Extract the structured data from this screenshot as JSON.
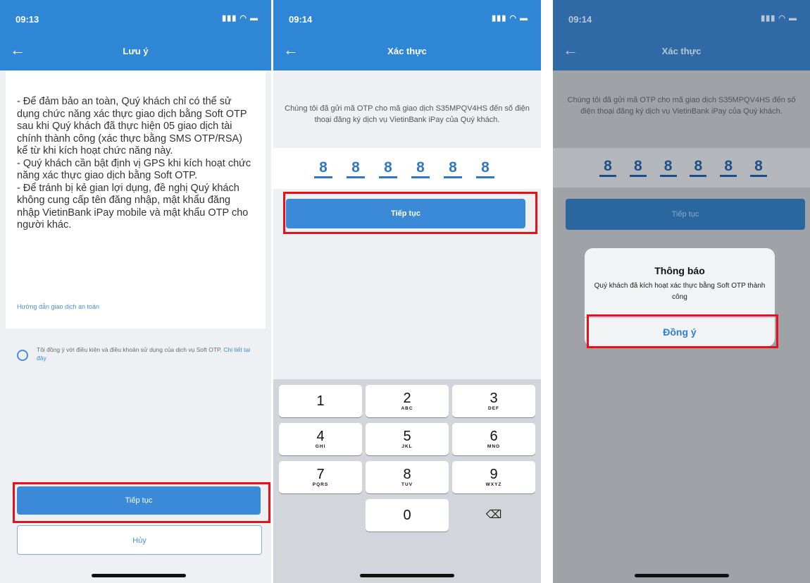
{
  "screen1": {
    "time": "09:13",
    "status_icons": "▮▮▮ ◠ ▬",
    "back_icon": "←",
    "title": "Lưu ý",
    "notice": [
      "- Để đảm bảo an toàn, Quý khách chỉ có thể sử dụng chức năng xác thực giao dịch bằng Soft OTP sau khi Quý khách đã thực hiện 05 giao dịch tài chính thành công  (xác thực bằng SMS OTP/RSA) kể từ khi kích hoạt chức năng này.",
      "- Quý khách cần bật định vị GPS khi kích hoạt chức năng xác thực giao dịch bằng Soft OTP.",
      "- Để tránh bị kẻ gian lợi dụng, đề nghị Quý khách không cung cấp tên đăng nhập, mật khẩu đăng nhập VietinBank iPay mobile và mật khẩu OTP cho người khác."
    ],
    "safe_link": "Hướng dẫn giao dịch an toàn",
    "agree_text": "Tôi đồng ý với điều kiện và điều khoản sử dụng của dịch vụ Soft OTP.",
    "agree_detail": "Chi tiết tại đây",
    "continue_label": "Tiếp tục",
    "cancel_label": "Hủy"
  },
  "screen2": {
    "time": "09:14",
    "status_icons": "▮▮▮ ◠ ▬",
    "back_icon": "←",
    "title": "Xác thực",
    "otp_message": "Chúng tôi đã gửi mã OTP cho mã giao dịch S35MPQV4HS đến số điện thoại đăng ký dịch vụ VietinBank iPay của Quý khách.",
    "otp_digits": [
      "8",
      "8",
      "8",
      "8",
      "8",
      "8"
    ],
    "continue_label": "Tiếp tục",
    "keys": [
      {
        "num": "1",
        "letters": ""
      },
      {
        "num": "2",
        "letters": "ABC"
      },
      {
        "num": "3",
        "letters": "DEF"
      },
      {
        "num": "4",
        "letters": "GHI"
      },
      {
        "num": "5",
        "letters": "JKL"
      },
      {
        "num": "6",
        "letters": "MNO"
      },
      {
        "num": "7",
        "letters": "PQRS"
      },
      {
        "num": "8",
        "letters": "TUV"
      },
      {
        "num": "9",
        "letters": "WXYZ"
      },
      {
        "num": "0",
        "letters": ""
      }
    ],
    "backspace_icon": "⌫"
  },
  "screen3": {
    "time": "09:14",
    "status_icons": "▮▮▮ ◠ ▬",
    "back_icon": "←",
    "title": "Xác thực",
    "otp_message": "Chúng tôi đã gửi mã OTP cho mã giao dịch S35MPQV4HS đến số điện thoại đăng ký dịch vụ VietinBank iPay của Quý khách.",
    "otp_digits": [
      "8",
      "8",
      "8",
      "8",
      "8",
      "8"
    ],
    "continue_label": "Tiếp tục",
    "alert": {
      "title": "Thông báo",
      "message": "Quý khách đã kích hoạt xác thực bằng Soft OTP thành công",
      "button": "Đồng ý"
    }
  },
  "colors": {
    "primary": "#2f86d6",
    "highlight": "#e6111b"
  }
}
